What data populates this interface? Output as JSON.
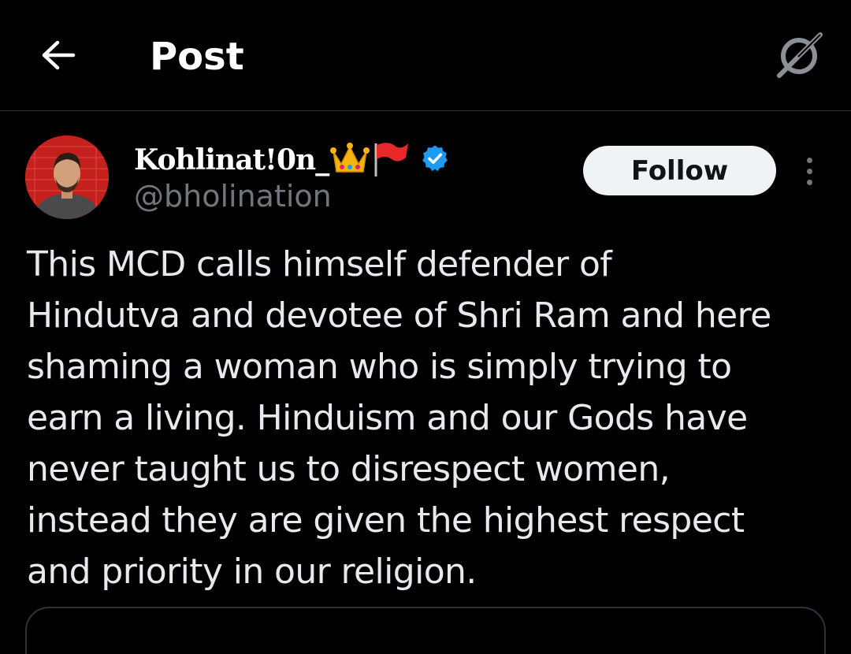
{
  "header": {
    "title": "Post",
    "back_icon": "arrow-left-icon",
    "grok_icon": "grok-icon"
  },
  "post": {
    "author": {
      "display_name": "Kohlinat!0n_",
      "emojis": [
        "crown",
        "red-flag"
      ],
      "verified": true,
      "verified_color": "#1d9bf0",
      "handle": "@bholination"
    },
    "follow_label": "Follow",
    "more_icon": "more-vertical-icon",
    "text": "This MCD calls himself defender of\nHindutva and devotee of Shri Ram and here\nshaming a woman who is simply trying to\nearn a living. Hinduism and our Gods have\nnever taught us to disrespect women,\ninstead they are given the highest respect\nand priority in our religion."
  },
  "colors": {
    "background": "#000000",
    "text_primary": "#e7e9ea",
    "text_secondary": "#71767b",
    "accent": "#1d9bf0",
    "follow_bg": "#eff3f4",
    "avatar_bg": "#c4201d"
  }
}
